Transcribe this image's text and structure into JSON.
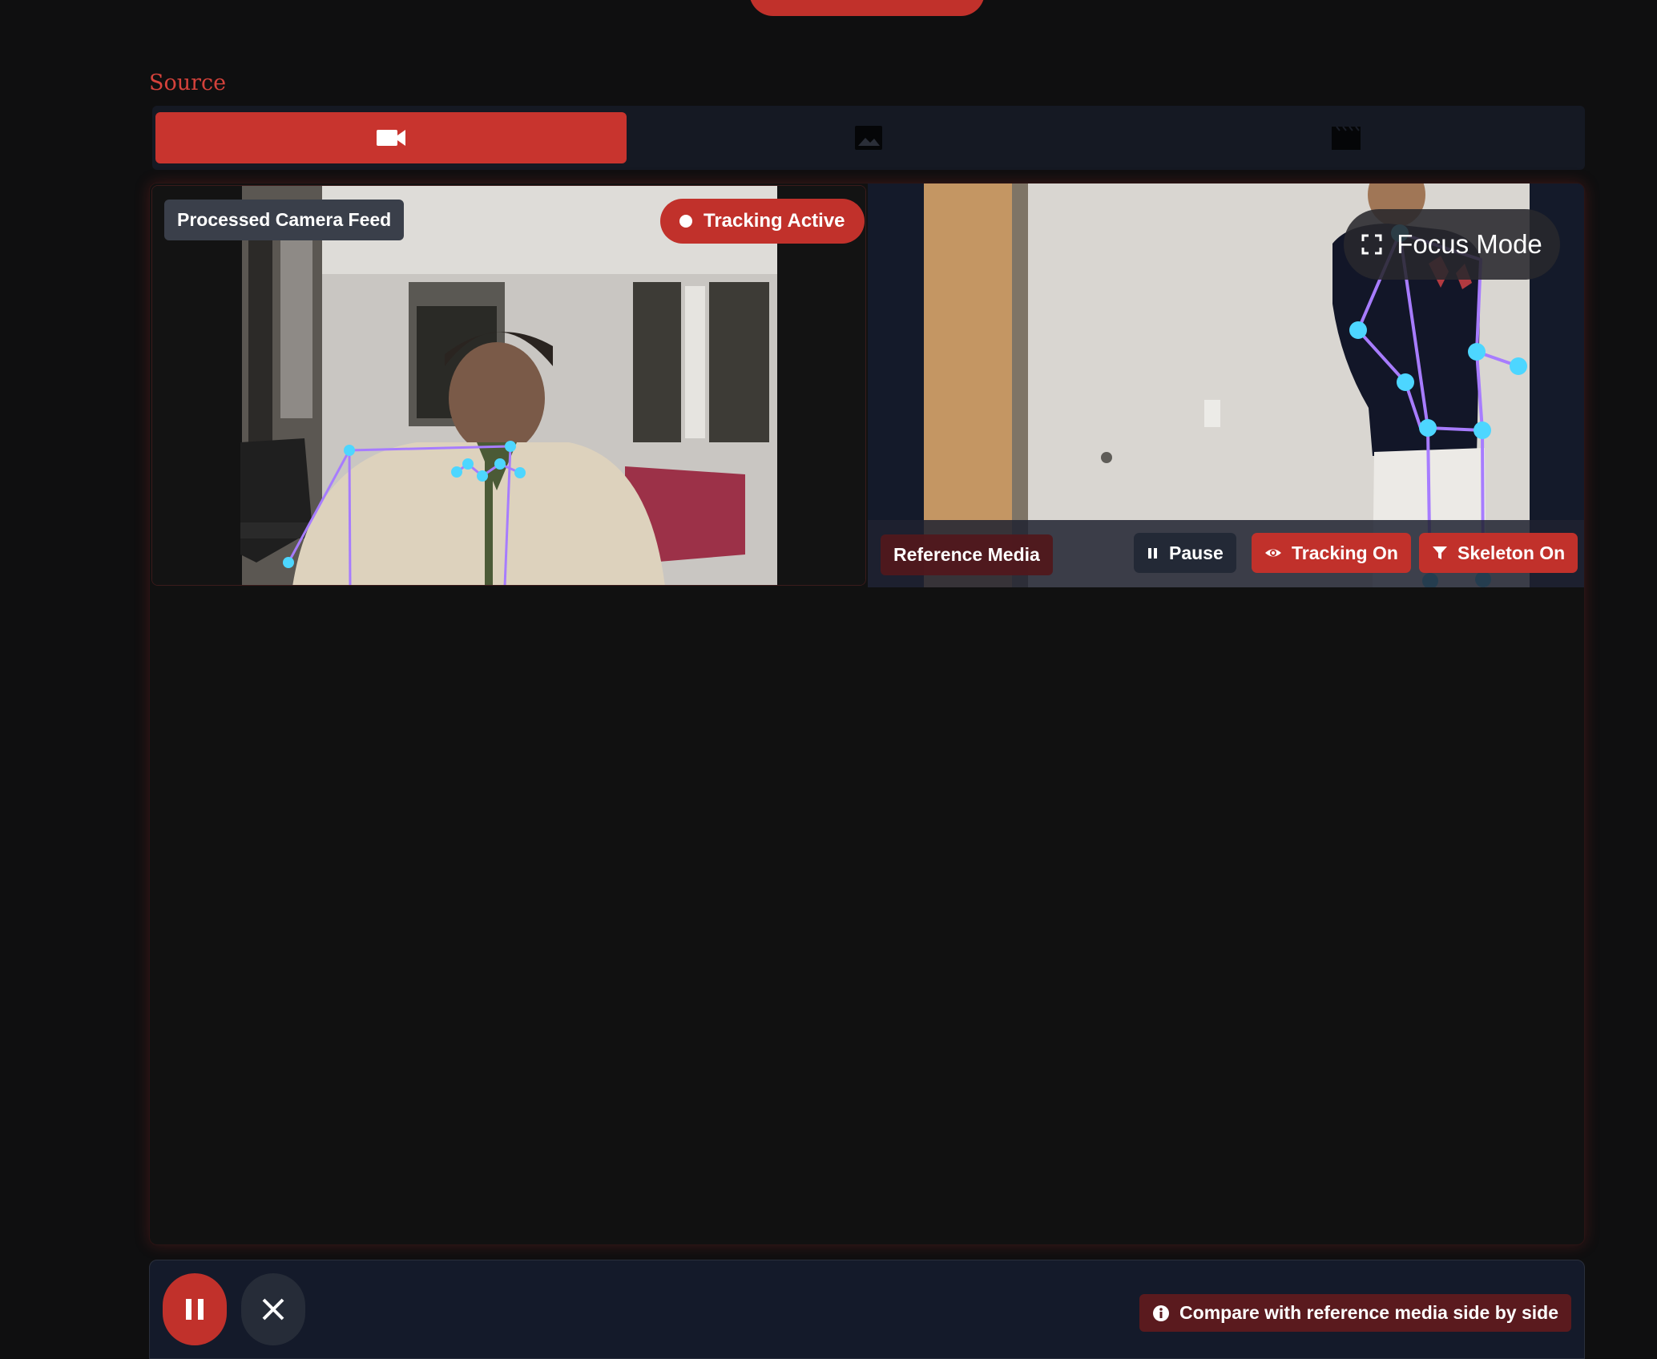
{
  "section": {
    "source_label": "Source"
  },
  "source_tabs": [
    {
      "icon": "video-camera-icon",
      "active": true
    },
    {
      "icon": "image-icon",
      "active": false
    },
    {
      "icon": "film-icon",
      "active": false
    }
  ],
  "camera": {
    "label": "Processed Camera Feed",
    "status": "Tracking Active"
  },
  "reference": {
    "focus_label": "Focus Mode",
    "label": "Reference Media",
    "pause_label": "Pause",
    "tracking_label": "Tracking On",
    "skeleton_label": "Skeleton On"
  },
  "bottom": {
    "hint": "Compare with reference media side by side"
  },
  "colors": {
    "accent": "#c1312b",
    "background": "#0f0f10",
    "panel": "#141a2a",
    "skeleton_line": "#a77cff",
    "skeleton_joint": "#4dd6ff"
  }
}
